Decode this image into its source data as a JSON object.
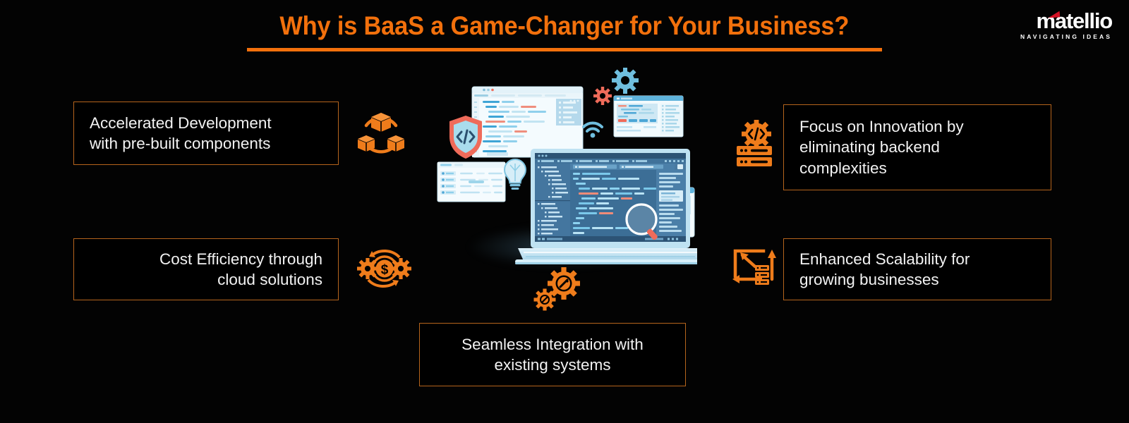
{
  "page": {
    "background_color": "#030303",
    "accent_color": "#f2700c",
    "border_color": "#b5641c",
    "text_color": "#f2f2f2"
  },
  "header": {
    "title": "Why is BaaS a Game-Changer for Your Business?",
    "title_color": "#f2700c",
    "underlined": true
  },
  "logo": {
    "wordmark": "matellio",
    "tagline": "NAVIGATING IDEAS",
    "accent_color": "#d41225",
    "text_color": "#ffffff"
  },
  "features": [
    {
      "id": "accelerated",
      "text": "Accelerated Development with pre-built components",
      "line1": "Accelerated Development",
      "line2": "with pre-built components",
      "align": "left",
      "side": "left",
      "icon": "modular-components-icon",
      "icon_color": "#ef7c1b"
    },
    {
      "id": "cost",
      "text": "Cost Efficiency through cloud solutions",
      "line1": "Cost Efficiency through",
      "line2": "cloud solutions",
      "align": "right",
      "side": "left",
      "icon": "cost-efficiency-icon",
      "icon_color": "#ef7c1b"
    },
    {
      "id": "focus",
      "text": "Focus on Innovation by eliminating backend complexities",
      "line1": "Focus on Innovation by",
      "line2": "eliminating backend",
      "line3": "complexities",
      "align": "left",
      "side": "right",
      "icon": "backend-server-icon",
      "icon_color": "#ef7c1b"
    },
    {
      "id": "scalability",
      "text": "Enhanced Scalability for growing businesses",
      "line1": "Enhanced Scalability for",
      "line2": "growing businesses",
      "align": "left",
      "side": "right",
      "icon": "scalability-icon",
      "icon_color": "#ef7c1b"
    },
    {
      "id": "seamless",
      "text": "Seamless Integration with existing systems",
      "line1": "Seamless Integration with",
      "line2": "existing systems",
      "align": "center",
      "side": "bottom",
      "icon": "integration-gears-icon",
      "icon_color": "#ef7c1b"
    }
  ],
  "illustration": {
    "name": "developer-workstation-illustration",
    "elements": [
      "laptop-with-code-editor",
      "floating-code-window",
      "floating-browser-window",
      "floating-form-card",
      "floating-mobile-card",
      "security-shield-code-icon",
      "blue-gear-icon",
      "coral-gear-icon",
      "wifi-icon",
      "lightbulb-icon",
      "magnifier-icon"
    ],
    "palette": {
      "laptop_screen": "#3d6e94",
      "laptop_body": "#bfe2f2",
      "window_light": "#eaf6fb",
      "accent_blue": "#4ba8d8",
      "accent_coral": "#ef6b5a",
      "dark_navy": "#2a4f6e"
    }
  }
}
